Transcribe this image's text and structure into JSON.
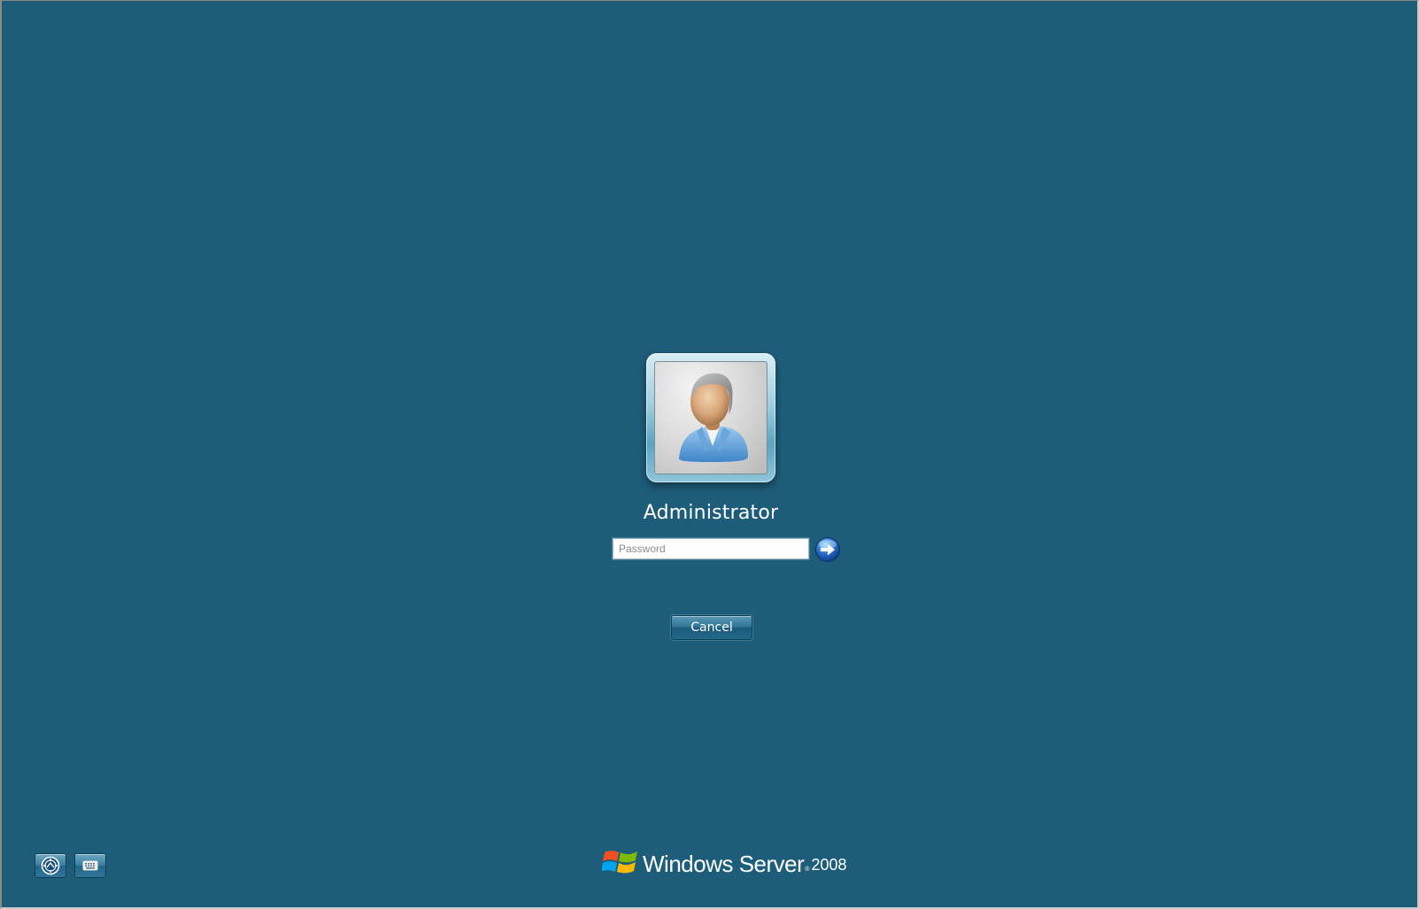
{
  "user": {
    "name": "Administrator",
    "avatar": "user-avatar-icon"
  },
  "password": {
    "placeholder": "Password",
    "value": ""
  },
  "submit": {
    "icon": "arrow-right-icon"
  },
  "cancel": {
    "label": "Cancel"
  },
  "corner_buttons": {
    "ease_of_access_icon": "ease-of-access-icon",
    "keyboard_icon": "on-screen-keyboard-icon"
  },
  "brand": {
    "name": "Windows Server",
    "trademark": "®",
    "version": "2008",
    "logo": "windows-flag-icon"
  },
  "colors": {
    "background": "#1e5d7a",
    "text": "#ffffff",
    "button": "#2f7394"
  }
}
